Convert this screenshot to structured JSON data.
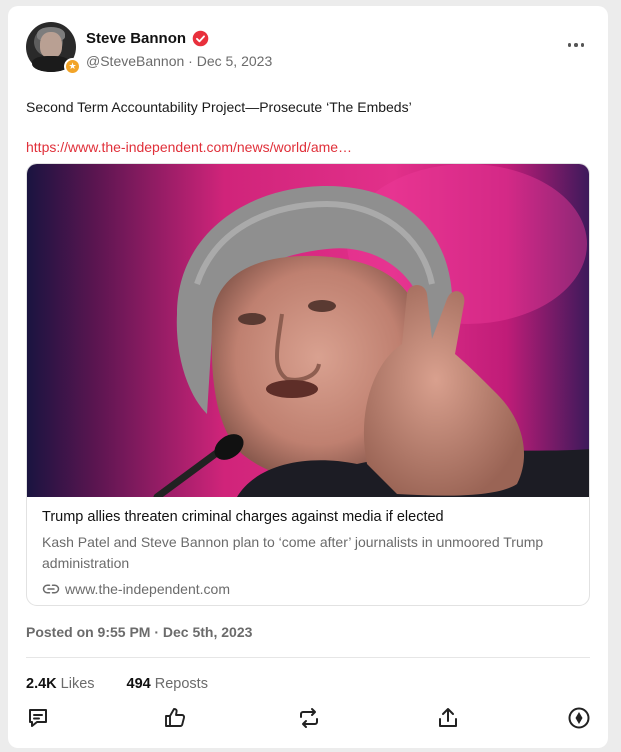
{
  "author": {
    "name": "Steve Bannon",
    "handle": "@SteveBannon",
    "separator": "·",
    "date": "Dec 5, 2023",
    "badge_glyph": "★"
  },
  "post": {
    "text": "Second Term Accountability Project—Prosecute ‘The Embeds’",
    "link_text": "https://www.the-independent.com/news/world/ame…"
  },
  "link_card": {
    "title": "Trump allies threaten criminal charges against media if elected",
    "description": "Kash Patel and Steve Bannon plan to ‘come after’ journalists in unmoored Trump administration",
    "domain": "www.the-independent.com"
  },
  "meta": {
    "posted_on": "Posted on 9:55 PM · Dec 5th, 2023"
  },
  "stats": {
    "likes_count": "2.4K",
    "likes_label": "Likes",
    "reposts_count": "494",
    "reposts_label": "Reposts"
  },
  "icons": {
    "verified": "verified-check-icon",
    "more": "more-horizontal-icon",
    "link": "link-icon",
    "reply": "reply-icon",
    "like": "thumbs-up-icon",
    "repost": "repost-icon",
    "share": "share-icon",
    "tip": "tip-icon"
  },
  "colors": {
    "accent": "#e0303a",
    "verified": "#e8303c",
    "badge": "#f2a428",
    "muted": "#6b6b6b"
  }
}
